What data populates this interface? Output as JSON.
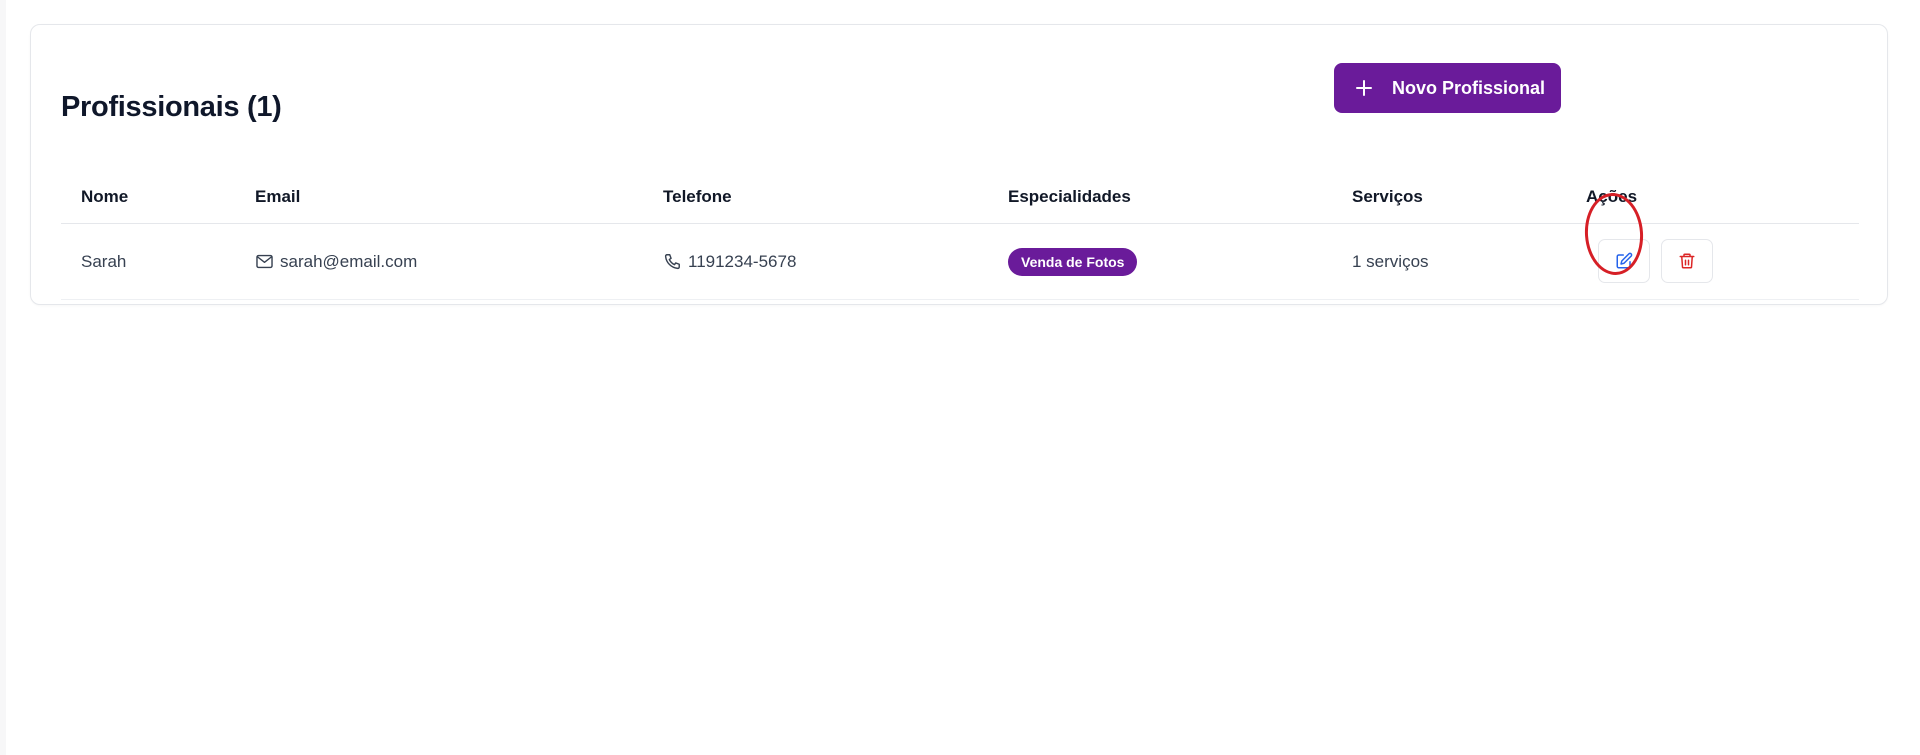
{
  "header": {
    "title": "Profissionais (1)",
    "new_button_label": "Novo Profissional"
  },
  "table": {
    "columns": [
      "Nome",
      "Email",
      "Telefone",
      "Especialidades",
      "Serviços",
      "Ações"
    ],
    "rows": [
      {
        "nome": "Sarah",
        "email": "sarah@email.com",
        "telefone": "1191234-5678",
        "especialidade": "Venda de Fotos",
        "servicos": "1 serviços"
      }
    ]
  },
  "icons": {
    "new": "plus-icon",
    "email": "mail-icon",
    "phone": "phone-icon",
    "edit": "edit-icon",
    "delete": "trash-icon"
  },
  "colors": {
    "accent": "#6a1b9a",
    "edit": "#2563eb",
    "delete": "#dc2626",
    "annotation": "#d61f26"
  }
}
